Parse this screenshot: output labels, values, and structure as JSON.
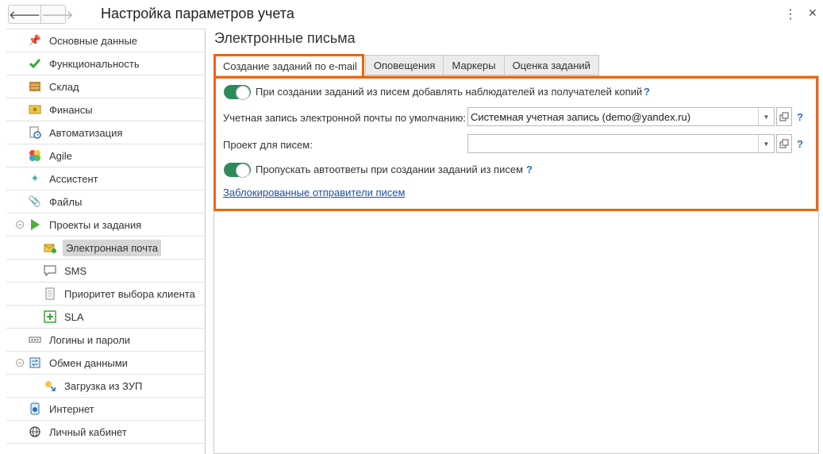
{
  "window": {
    "title": "Настройка параметров учета",
    "back_icon": "arrow-left-icon",
    "forward_icon": "arrow-right-icon",
    "more_icon": "more-vertical-icon",
    "close_icon": "close-icon"
  },
  "sidebar": {
    "items": [
      {
        "label": "Основные данные",
        "icon": "pin-icon"
      },
      {
        "label": "Функциональность",
        "icon": "checkmark-icon"
      },
      {
        "label": "Склад",
        "icon": "warehouse-icon"
      },
      {
        "label": "Финансы",
        "icon": "finance-icon"
      },
      {
        "label": "Автоматизация",
        "icon": "automation-icon"
      },
      {
        "label": "Agile",
        "icon": "agile-icon"
      },
      {
        "label": "Ассистент",
        "icon": "sparkle-icon"
      },
      {
        "label": "Файлы",
        "icon": "paperclip-icon"
      },
      {
        "label": "Проекты и задания",
        "icon": "play-icon",
        "expanded": true
      },
      {
        "label": "Электронная почта",
        "icon": "email-icon",
        "selected": true
      },
      {
        "label": "SMS",
        "icon": "speech-bubble-icon"
      },
      {
        "label": "Приоритет выбора клиента",
        "icon": "document-icon"
      },
      {
        "label": "SLA",
        "icon": "sla-plus-icon"
      },
      {
        "label": "Логины и пароли",
        "icon": "password-icon"
      },
      {
        "label": "Обмен данными",
        "icon": "exchange-icon",
        "expanded": true
      },
      {
        "label": "Загрузка из ЗУП",
        "icon": "import-icon"
      },
      {
        "label": "Интернет",
        "icon": "internet-icon"
      },
      {
        "label": "Личный кабинет",
        "icon": "globe-icon"
      }
    ]
  },
  "main": {
    "title": "Электронные письма",
    "tabs": [
      {
        "label": "Создание заданий по e-mail",
        "active": true
      },
      {
        "label": "Оповещения"
      },
      {
        "label": "Маркеры"
      },
      {
        "label": "Оценка заданий"
      }
    ],
    "option1": "При создании заданий из писем добавлять наблюдателей из получателей копий",
    "account_label": "Учетная запись электронной почты по умолчанию:",
    "account_value": "Системная учетная запись (demo@yandex.ru)",
    "project_label": "Проект для писем:",
    "project_value": "",
    "option2": "Пропускать автоответы при создании заданий из писем",
    "blocked_link": "Заблокированные отправители писем",
    "help": "?"
  },
  "colors": {
    "highlight": "#f0640a",
    "toggle_on": "#2e8b57",
    "link": "#1f4ea0",
    "help": "#2a6ebb"
  }
}
